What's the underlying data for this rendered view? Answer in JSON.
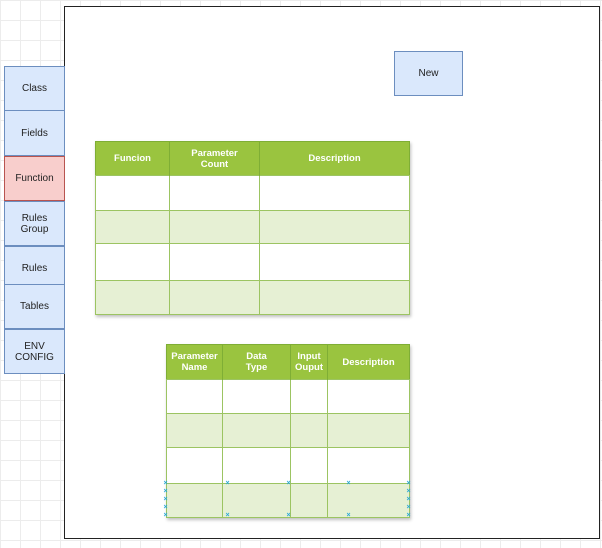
{
  "sidebar": {
    "items": [
      {
        "label": "Class"
      },
      {
        "label": "Fields"
      },
      {
        "label": "Function"
      },
      {
        "label": "Rules\nGroup"
      },
      {
        "label": "Rules"
      },
      {
        "label": "Tables"
      },
      {
        "label": "ENV\nCONFIG"
      }
    ],
    "active_index": 2
  },
  "canvas": {
    "new_button_label": "New"
  },
  "function_table": {
    "headers": [
      "Funcion",
      "Parameter\nCount",
      "Description"
    ]
  },
  "parameter_table": {
    "headers": [
      "Parameter\nName",
      "Data\nType",
      "Input\nOuput",
      "Description"
    ]
  },
  "colors": {
    "sidebar_fill": "#dae8fc",
    "sidebar_border": "#6c8ebf",
    "active_fill": "#f8cecc",
    "active_border": "#b85450",
    "table_header": "#9ac43f",
    "table_alt_row": "#e6f0d4",
    "selection_marker": "#27a8d6"
  },
  "icons": [
    "selection-handle-icon"
  ]
}
